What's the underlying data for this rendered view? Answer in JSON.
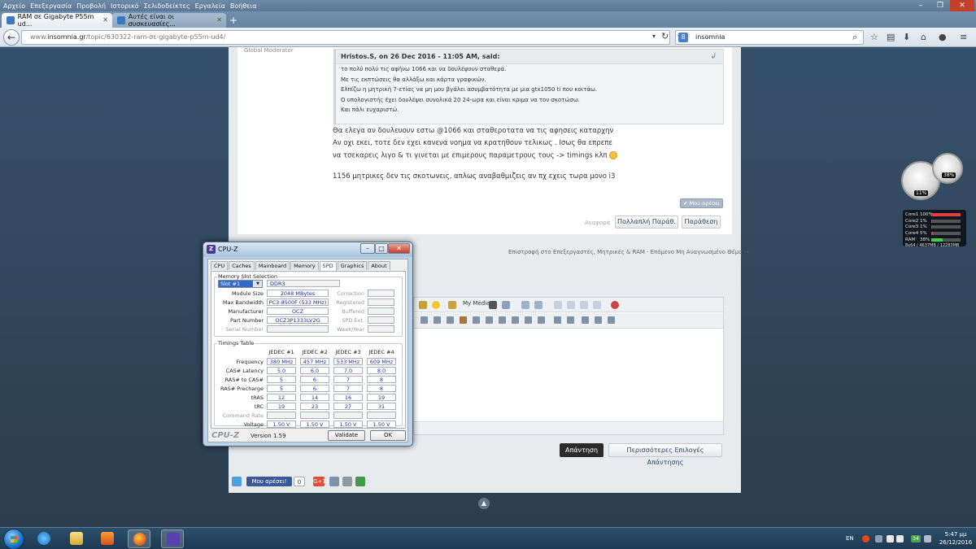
{
  "browser": {
    "menu": [
      "Αρχείο",
      "Επεξεργασία",
      "Προβολή",
      "Ιστορικό",
      "Σελιδοδείκτες",
      "Εργαλεία",
      "Βοήθεια"
    ],
    "tabs": [
      {
        "title": "RAM σε Gigabyte P55m ud..."
      },
      {
        "title": "Αυτές είναι οι συσκευασίες..."
      }
    ],
    "url_prefix": "www.",
    "url_host": "insomnia.gr",
    "url_path": "/topic/630322-ram-σε-gigabyte-p55m-ud4/",
    "search_value": "insomnia",
    "search_engine_badge": "8"
  },
  "post": {
    "author_stub": "Global Moderator",
    "quote": {
      "header": "Hristos.S, on 26 Dec 2016 - 11:05 AM, said:",
      "lines": [
        "το πολύ πολύ τις αφήνω 1066 και να δουλέψουν σταθερά.",
        "Με τις εκπτώσεις θα αλλάξω και κάρτα γραφικών.",
        "Ελπίζω η μητρική 7-ετίας να μη μου βγάλει ασυμβατότητα με μια gtx1050 ti που κοιτάω.",
        "Ο υπολογιστής έχει δουλέψει συνολικά 20   24-ωρα και είναι κριμα να τον σκοτώσω.",
        "Και πάλι ευχαριστώ."
      ]
    },
    "body_lines": [
      "Θα ελεγα αν δουλευουν εστω @1066 και σταθεροτατα να τις αφησεις καταρχην",
      "Αν οχι εκει, τοτε δεν εχει κανενα νοημα να κρατηθουν τελικως . Ισως θα επρεπε",
      "να τσεκαρεις λιγο & τι γινεται με επιμερους παραμετρους τους -> timings κλπ",
      "1156 μητρικες δεν τις σκοτωνεις, απλως αναβαθμιζεις αν πχ εχεις τωρα μονο i3"
    ],
    "like_label": "✔ Μου αρέσει",
    "report_label": "Αναφορά",
    "multiquote_label": "Πολλαπλή Παράθ.",
    "quote_label": "Παράθεση"
  },
  "nav_links": "Επιστροφή στο Επεξεργαστές, Μητρικές & RAM · Επόμενο Μη Αναγνωσμένο Θέμα →",
  "editor": {
    "mymedia_label": "My Media",
    "reply_label": "Απάντηση",
    "more_options_label": "Περισσότερες Επιλογές Απάντησης"
  },
  "share": {
    "fb_label": "Μου αρέσει!",
    "fb_count": "0",
    "gplus_label": "G+1"
  },
  "gadgets": {
    "gauge_big_value": "11%",
    "gauge_small_value": "38%",
    "cores": [
      {
        "label": "Core1",
        "value": "100%",
        "fraction": 1.0,
        "color": "#e04040"
      },
      {
        "label": "Core2",
        "value": "1%",
        "fraction": 0.01,
        "color": "#e04040"
      },
      {
        "label": "Core3",
        "value": "1%",
        "fraction": 0.01,
        "color": "#e04040"
      },
      {
        "label": "Core4",
        "value": "5%",
        "fraction": 0.05,
        "color": "#e04040"
      },
      {
        "label": "RAM",
        "value": "38%",
        "fraction": 0.38,
        "color": "#40d040"
      }
    ],
    "mem_summary": "8x64 / 4637MB / 12283MB"
  },
  "cpuz": {
    "title": "CPU-Z",
    "tabs": [
      "CPU",
      "Caches",
      "Mainboard",
      "Memory",
      "SPD",
      "Graphics",
      "About"
    ],
    "active_tab": "SPD",
    "slot_group_label": "Memory Slot Selection",
    "slot_selected": "Slot #1",
    "memory_type": "DDR3",
    "fields": {
      "module_size": {
        "label": "Module Size",
        "value": "2048 MBytes"
      },
      "max_bandwidth": {
        "label": "Max Bandwidth",
        "value": "PC3-8500F (533 MHz)"
      },
      "manufacturer": {
        "label": "Manufacturer",
        "value": "OCZ"
      },
      "part_number": {
        "label": "Part Number",
        "value": "OCZ3P1333LV2G"
      },
      "serial_number": {
        "label": "Serial Number",
        "value": ""
      }
    },
    "right_fields": [
      "Correction",
      "Registered",
      "Buffered",
      "SPD Ext.",
      "Week/Year"
    ],
    "timings_group_label": "Timings Table",
    "timing_headers": [
      "JEDEC #1",
      "JEDEC #2",
      "JEDEC #3",
      "JEDEC #4"
    ],
    "timing_rows": [
      {
        "label": "Frequency",
        "values": [
          "380 MHz",
          "457 MHz",
          "533 MHz",
          "609 MHz"
        ]
      },
      {
        "label": "CAS# Latency",
        "values": [
          "5.0",
          "6.0",
          "7.0",
          "8.0"
        ]
      },
      {
        "label": "RAS# to CAS#",
        "values": [
          "5",
          "6",
          "7",
          "8"
        ]
      },
      {
        "label": "RAS# Precharge",
        "values": [
          "5",
          "6",
          "7",
          "8"
        ]
      },
      {
        "label": "tRAS",
        "values": [
          "12",
          "14",
          "16",
          "19"
        ]
      },
      {
        "label": "tRC",
        "values": [
          "19",
          "23",
          "27",
          "31"
        ]
      },
      {
        "label": "Command Rate",
        "values": [
          "",
          "",
          "",
          ""
        ]
      },
      {
        "label": "Voltage",
        "values": [
          "1.50 V",
          "1.50 V",
          "1.50 V",
          "1.50 V"
        ]
      }
    ],
    "brand": "CPU-Z",
    "version": "Version 1.59",
    "validate_label": "Validate",
    "ok_label": "OK"
  },
  "taskbar": {
    "language": "EN",
    "time": "5:47 μμ",
    "date": "26/12/2016",
    "tray_badge": "34"
  }
}
